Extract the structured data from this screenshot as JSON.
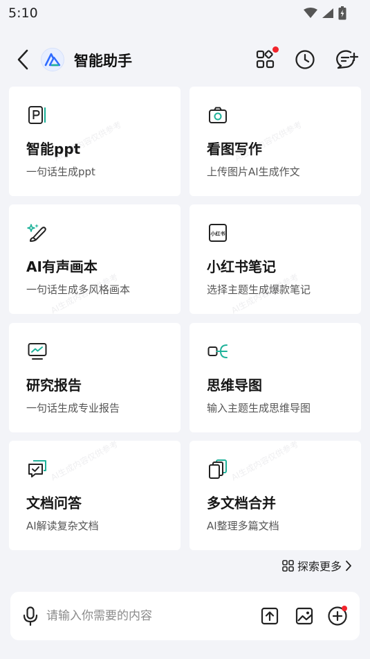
{
  "status_bar": {
    "time": "5:10"
  },
  "header": {
    "title": "智能助手"
  },
  "cards": [
    {
      "id": "ppt",
      "title": "智能ppt",
      "desc": "一句话生成ppt",
      "icon": "ppt-icon"
    },
    {
      "id": "image-writing",
      "title": "看图写作",
      "desc": "上传图片AI生成作文",
      "icon": "camera-icon"
    },
    {
      "id": "picture-book",
      "title": "AI有声画本",
      "desc": "一句话生成多风格画本",
      "icon": "magic-brush-icon"
    },
    {
      "id": "xiaohongshu",
      "title": "小红书笔记",
      "desc": "选择主题生成爆款笔记",
      "icon": "xiaohongshu-icon",
      "icon_text": "小红书"
    },
    {
      "id": "report",
      "title": "研究报告",
      "desc": "一句话生成专业报告",
      "icon": "chart-monitor-icon"
    },
    {
      "id": "mindmap",
      "title": "思维导图",
      "desc": "输入主题生成思维导图",
      "icon": "mindmap-icon"
    },
    {
      "id": "doc-qa",
      "title": "文档问答",
      "desc": "AI解读复杂文档",
      "icon": "chat-check-icon"
    },
    {
      "id": "doc-merge",
      "title": "多文档合并",
      "desc": "AI整理多篇文档",
      "icon": "stacked-docs-icon"
    }
  ],
  "watermark_text": "AI生成内容仅供参考",
  "explore": {
    "label": "探索更多"
  },
  "input": {
    "placeholder": "请输入你需要的内容"
  },
  "colors": {
    "accent_teal": "#1fb29a",
    "badge_red": "#f2242c",
    "logo_blue": "#2f6bff"
  }
}
